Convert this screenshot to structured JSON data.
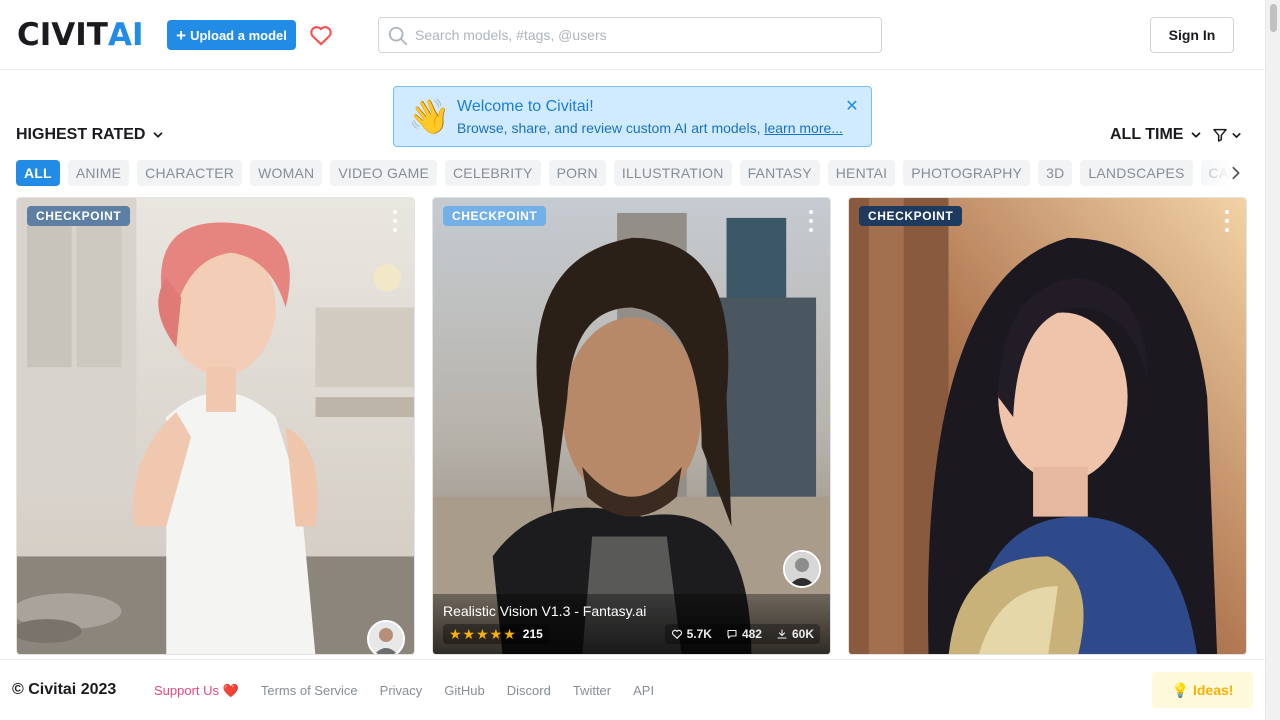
{
  "header": {
    "logo": {
      "part1": "CIVIT",
      "part2": "AI"
    },
    "upload_label": "Upload a model",
    "search_placeholder": "Search models, #tags, @users",
    "signin_label": "Sign In"
  },
  "alert": {
    "emoji": "👋",
    "title": "Welcome to Civitai!",
    "body": "Browse, share, and review custom AI art models, ",
    "link": "learn more...",
    "close": "✕"
  },
  "controls": {
    "sort_label": "HIGHEST RATED",
    "period_label": "ALL TIME"
  },
  "tags": [
    "ALL",
    "ANIME",
    "CHARACTER",
    "WOMAN",
    "VIDEO GAME",
    "CELEBRITY",
    "PORN",
    "ILLUSTRATION",
    "FANTASY",
    "HENTAI",
    "PHOTOGRAPHY",
    "3D",
    "LANDSCAPES",
    "CARS"
  ],
  "active_tag": "ALL",
  "cards": [
    {
      "badge": "CHECKPOINT",
      "badge_color": "#5c7fa3"
    },
    {
      "badge": "CHECKPOINT",
      "badge_color": "#74b0e8",
      "name": "Realistic Vision V1.3 - Fantasy.ai",
      "rating_count": "215",
      "likes": "5.7K",
      "comments": "482",
      "downloads": "60K"
    },
    {
      "badge": "CHECKPOINT",
      "badge_color": "#1e3a5f"
    }
  ],
  "footer": {
    "copyright": "© Civitai 2023",
    "support": "Support Us ❤️",
    "terms": "Terms of Service",
    "privacy": "Privacy",
    "github": "GitHub",
    "discord": "Discord",
    "twitter": "Twitter",
    "api": "API",
    "ideas": "Ideas!"
  },
  "colors": {
    "primary": "#228be6",
    "alert_bg": "#d0ebff",
    "star": "#fab005",
    "heart": "#fa5252"
  }
}
